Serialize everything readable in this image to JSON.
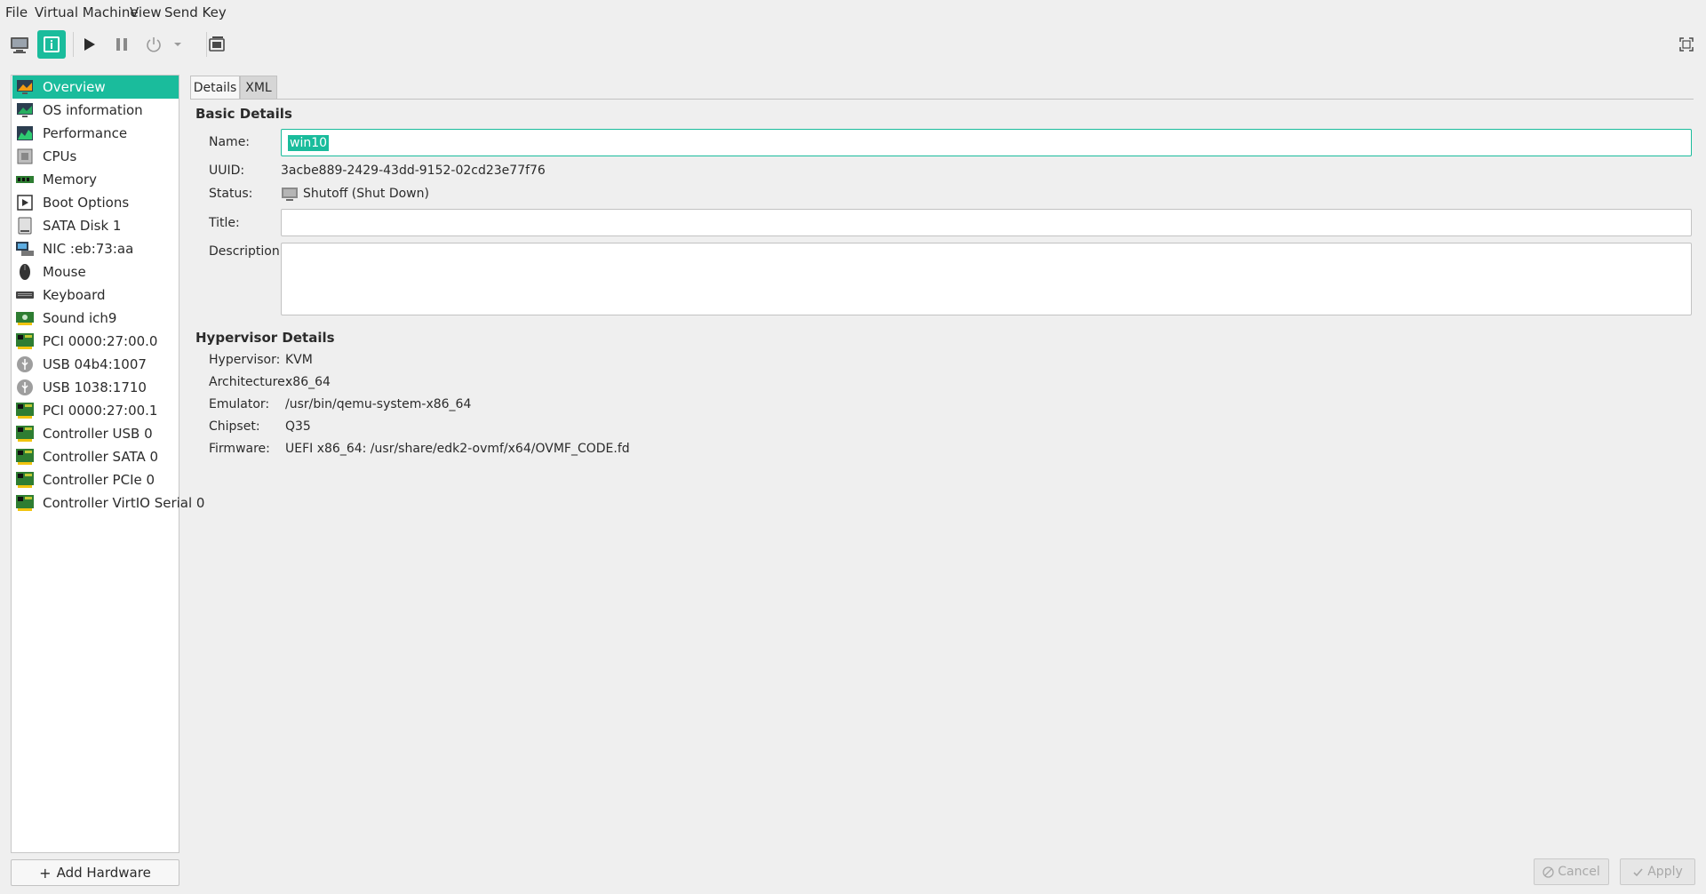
{
  "menubar": {
    "items": [
      "File",
      "Virtual Machine",
      "View",
      "Send Key"
    ]
  },
  "sidebar": {
    "items": [
      {
        "label": "Overview",
        "icon": "overview-monitor-icon"
      },
      {
        "label": "OS information",
        "icon": "os-info-icon"
      },
      {
        "label": "Performance",
        "icon": "performance-graph-icon"
      },
      {
        "label": "CPUs",
        "icon": "cpu-chip-icon"
      },
      {
        "label": "Memory",
        "icon": "memory-stick-icon"
      },
      {
        "label": "Boot Options",
        "icon": "boot-options-icon"
      },
      {
        "label": "SATA Disk 1",
        "icon": "disk-icon"
      },
      {
        "label": "NIC :eb:73:aa",
        "icon": "network-card-icon"
      },
      {
        "label": "Mouse",
        "icon": "mouse-icon"
      },
      {
        "label": "Keyboard",
        "icon": "keyboard-icon"
      },
      {
        "label": "Sound ich9",
        "icon": "sound-card-icon"
      },
      {
        "label": "PCI 0000:27:00.0",
        "icon": "pci-card-icon"
      },
      {
        "label": "USB 04b4:1007",
        "icon": "usb-icon"
      },
      {
        "label": "USB 1038:1710",
        "icon": "usb-icon"
      },
      {
        "label": "PCI 0000:27:00.1",
        "icon": "pci-card-icon"
      },
      {
        "label": "Controller USB 0",
        "icon": "controller-card-icon"
      },
      {
        "label": "Controller SATA 0",
        "icon": "controller-card-icon"
      },
      {
        "label": "Controller PCIe 0",
        "icon": "controller-card-icon"
      },
      {
        "label": "Controller VirtIO Serial 0",
        "icon": "controller-card-icon"
      }
    ],
    "add_hardware": "Add Hardware"
  },
  "tabs": {
    "details": "Details",
    "xml": "XML"
  },
  "basic": {
    "title": "Basic Details",
    "name_label": "Name:",
    "name_value": "win10",
    "uuid_label": "UUID:",
    "uuid_value": "3acbe889-2429-43dd-9152-02cd23e77f76",
    "status_label": "Status:",
    "status_value": "Shutoff (Shut Down)",
    "title_label": "Title:",
    "title_value": "",
    "desc_label": "Description:",
    "desc_value": ""
  },
  "hypervisor": {
    "title": "Hypervisor Details",
    "hypervisor_label": "Hypervisor:",
    "hypervisor_value": "KVM",
    "arch_label": "Architecture:",
    "arch_value": "x86_64",
    "emulator_label": "Emulator:",
    "emulator_value": "/usr/bin/qemu-system-x86_64",
    "chipset_label": "Chipset:",
    "chipset_value": "Q35",
    "firmware_label": "Firmware:",
    "firmware_value": "UEFI x86_64: /usr/share/edk2-ovmf/x64/OVMF_CODE.fd"
  },
  "buttons": {
    "cancel": "Cancel",
    "apply": "Apply"
  },
  "colors": {
    "accent": "#1abc9c"
  }
}
